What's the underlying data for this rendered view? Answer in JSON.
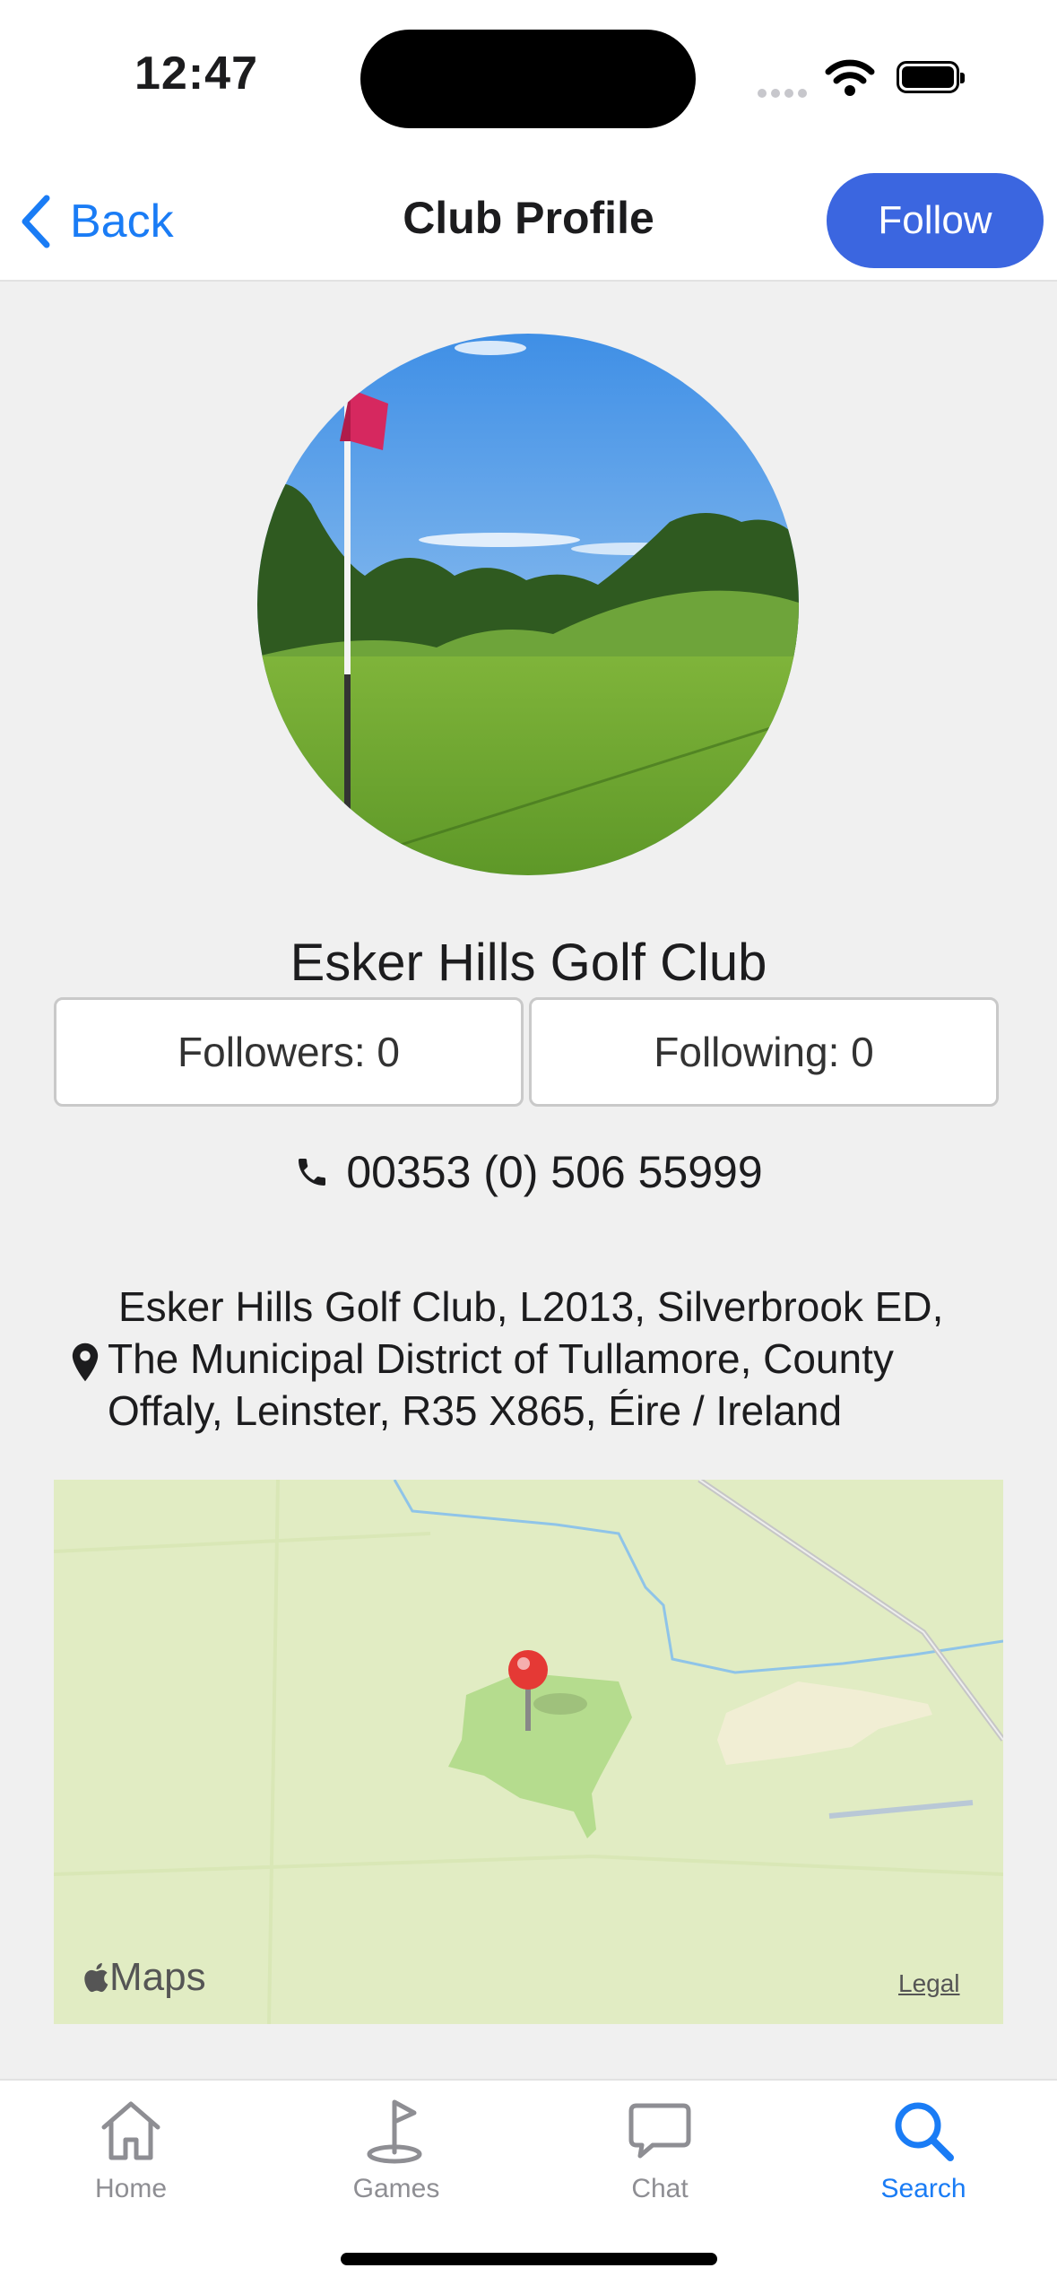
{
  "status_bar": {
    "time": "12:47"
  },
  "nav": {
    "back_label": "Back",
    "title": "Club Profile",
    "follow_label": "Follow"
  },
  "club": {
    "name": "Esker Hills Golf Club",
    "followers_label": "Followers: 0",
    "following_label": "Following: 0",
    "phone": "00353 (0) 506 55999",
    "address": "Esker Hills Golf Club, L2013, Silverbrook ED, The Municipal District of Tullamore, County Offaly, Leinster, R35 X865, Éire / Ireland"
  },
  "map": {
    "brand": "Maps",
    "legal": "Legal"
  },
  "tabs": [
    {
      "label": "Home",
      "icon": "home-icon",
      "active": false
    },
    {
      "label": "Games",
      "icon": "golf-flag-icon",
      "active": false
    },
    {
      "label": "Chat",
      "icon": "chat-bubble-icon",
      "active": false
    },
    {
      "label": "Search",
      "icon": "search-icon",
      "active": true
    }
  ],
  "colors": {
    "accent": "#1a7cf5",
    "follow_button": "#3b66e0",
    "background": "#f0f0f0",
    "map_land": "#e1ecc3",
    "pin": "#e53935"
  }
}
